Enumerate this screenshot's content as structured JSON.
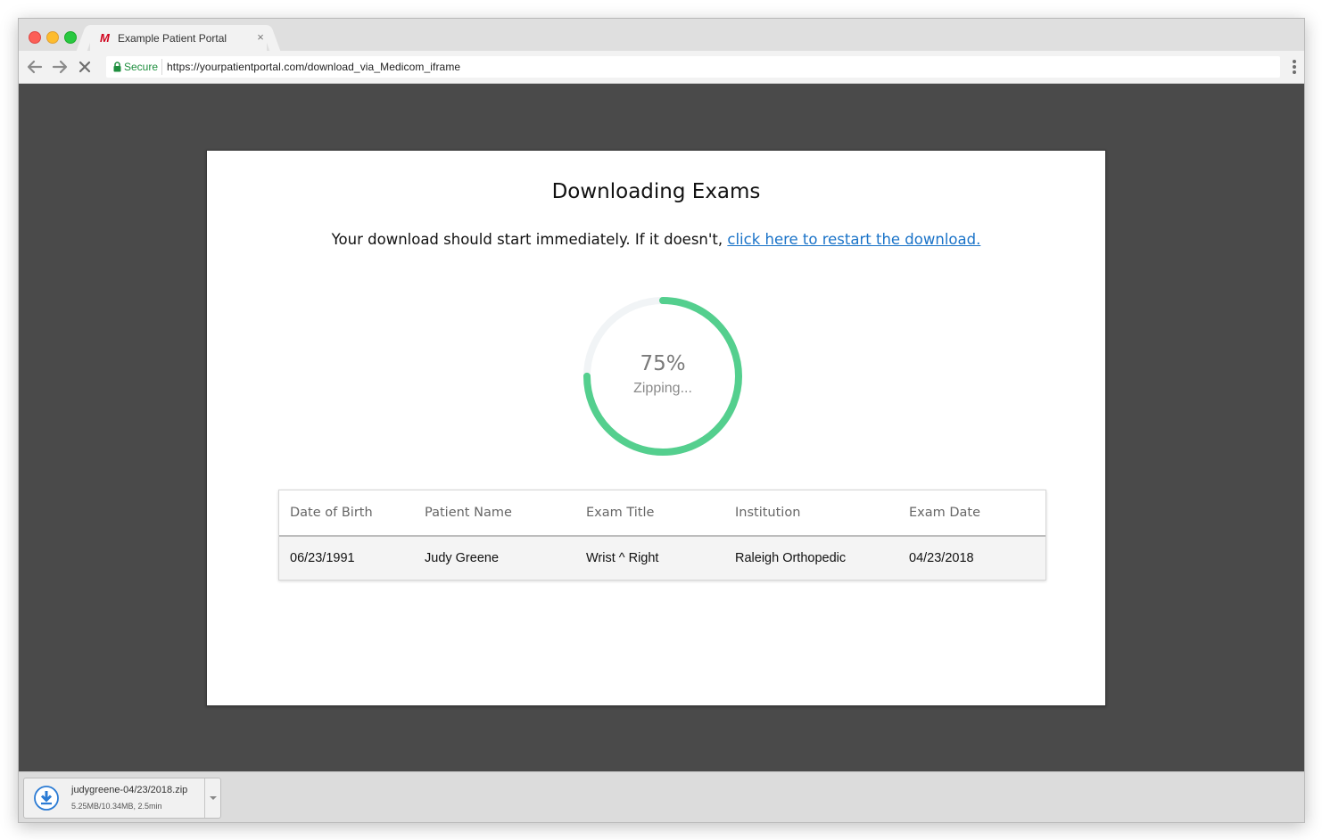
{
  "browser": {
    "tab": {
      "favicon": "M",
      "title": "Example Patient Portal",
      "close_icon": "close-icon"
    },
    "nav": {
      "back_icon": "arrow-left-icon",
      "forward_icon": "arrow-right-icon",
      "stop_icon": "close-icon"
    },
    "omnibox": {
      "secure_label": "Secure",
      "url": "https://yourpatientportal.com/download_via_Medicom_iframe"
    },
    "menu_icon": "more-vertical-icon"
  },
  "modal": {
    "title": "Downloading Exams",
    "message": "Your download should start immediately. If it doesn't, ",
    "restart_link": "click here to restart the download."
  },
  "progress": {
    "percent": 75,
    "percent_label": "75%",
    "status": "Zipping...",
    "color": "#54cf8e",
    "track_color": "#f1f4f6"
  },
  "exams": {
    "columns": [
      "Date of Birth",
      "Patient Name",
      "Exam Title",
      "Institution",
      "Exam Date"
    ],
    "rows": [
      [
        "06/23/1991",
        "Judy Greene",
        "Wrist ^ Right",
        "Raleigh Orthopedic",
        "04/23/2018"
      ]
    ]
  },
  "download": {
    "filename": "judygreene-04/23/2018.zip",
    "status": "5.25MB/10.34MB, 2.5min",
    "icon": "download-icon",
    "menu_icon": "chevron-down-icon"
  },
  "colors": {
    "link": "#1a73c8",
    "secure": "#1e8e3e",
    "brand": "#d0021b",
    "download_icon": "#2b7bd4"
  }
}
